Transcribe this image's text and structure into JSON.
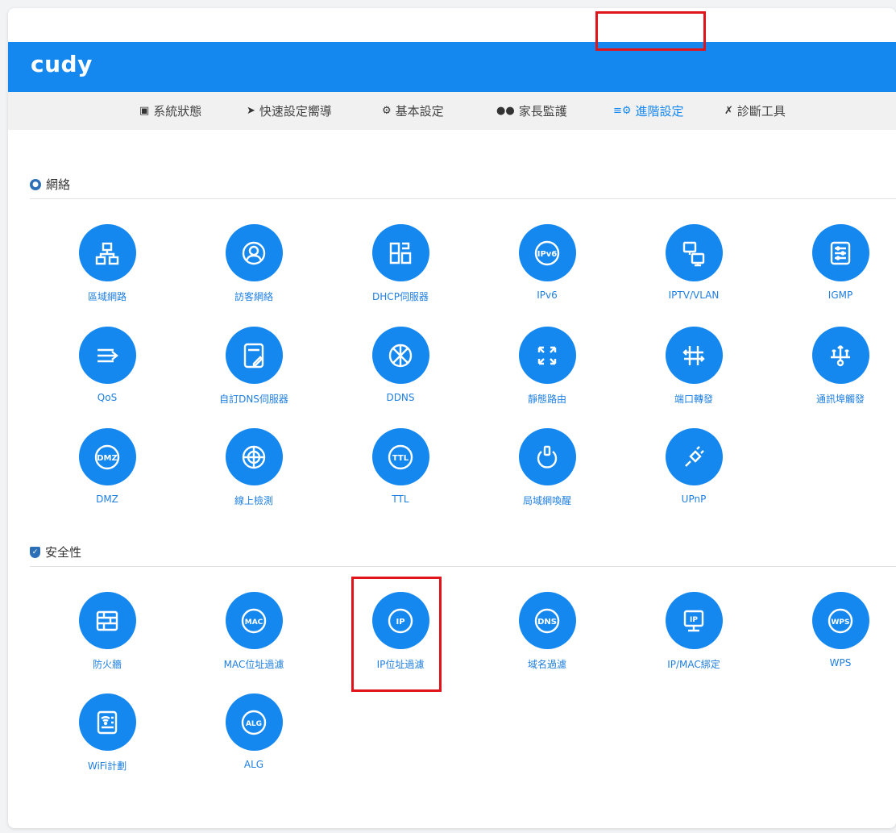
{
  "brand": {
    "logo": "cudy"
  },
  "nav": {
    "items": [
      {
        "label": "系統狀態",
        "icon": "monitor-icon"
      },
      {
        "label": "快速設定嚮導",
        "icon": "rocket-icon"
      },
      {
        "label": "基本設定",
        "icon": "gear-icon"
      },
      {
        "label": "家長監護",
        "icon": "family-icon"
      },
      {
        "label": "進階設定",
        "icon": "sliders-icon",
        "active": true
      },
      {
        "label": "診斷工具",
        "icon": "tools-icon"
      }
    ]
  },
  "sections": [
    {
      "title": "網絡",
      "icon": "globe-icon",
      "tiles": [
        {
          "label": "區域網路",
          "icon": "lan-icon"
        },
        {
          "label": "訪客網絡",
          "icon": "guest-icon"
        },
        {
          "label": "DHCP伺服器",
          "icon": "dhcp-icon"
        },
        {
          "label": "IPv6",
          "icon": "ipv6-icon"
        },
        {
          "label": "IPTV/VLAN",
          "icon": "iptv-icon"
        },
        {
          "label": "IGMP",
          "icon": "igmp-icon"
        },
        {
          "label": "QoS",
          "icon": "qos-icon"
        },
        {
          "label": "自訂DNS伺服器",
          "icon": "custom-dns-icon"
        },
        {
          "label": "DDNS",
          "icon": "ddns-icon"
        },
        {
          "label": "靜態路由",
          "icon": "static-route-icon"
        },
        {
          "label": "端口轉發",
          "icon": "port-forward-icon"
        },
        {
          "label": "通訊埠觸發",
          "icon": "port-trigger-icon"
        },
        {
          "label": "DMZ",
          "icon": "dmz-icon"
        },
        {
          "label": "線上檢測",
          "icon": "online-detect-icon"
        },
        {
          "label": "TTL",
          "icon": "ttl-icon"
        },
        {
          "label": "局域網喚醒",
          "icon": "wol-icon"
        },
        {
          "label": "UPnP",
          "icon": "upnp-icon"
        }
      ]
    },
    {
      "title": "安全性",
      "icon": "shield-icon",
      "tiles": [
        {
          "label": "防火牆",
          "icon": "firewall-icon"
        },
        {
          "label": "MAC位址過濾",
          "icon": "mac-filter-icon"
        },
        {
          "label": "IP位址過濾",
          "icon": "ip-filter-icon",
          "highlighted": true
        },
        {
          "label": "域名過濾",
          "icon": "domain-filter-icon"
        },
        {
          "label": "IP/MAC綁定",
          "icon": "ip-mac-bind-icon"
        },
        {
          "label": "WPS",
          "icon": "wps-icon"
        },
        {
          "label": "WiFi計劃",
          "icon": "wifi-schedule-icon"
        },
        {
          "label": "ALG",
          "icon": "alg-icon"
        }
      ]
    }
  ],
  "icon_text": {
    "ipv6": "IPv6",
    "dns": "DNS",
    "dmz": "DMZ",
    "ttl": "TTL",
    "mac": "MAC",
    "ip": "IP",
    "wps": "WPS",
    "alg": "ALG"
  },
  "colors": {
    "brand": "#1588f0",
    "highlight": "#e0141b",
    "label": "#1f7fe0"
  }
}
